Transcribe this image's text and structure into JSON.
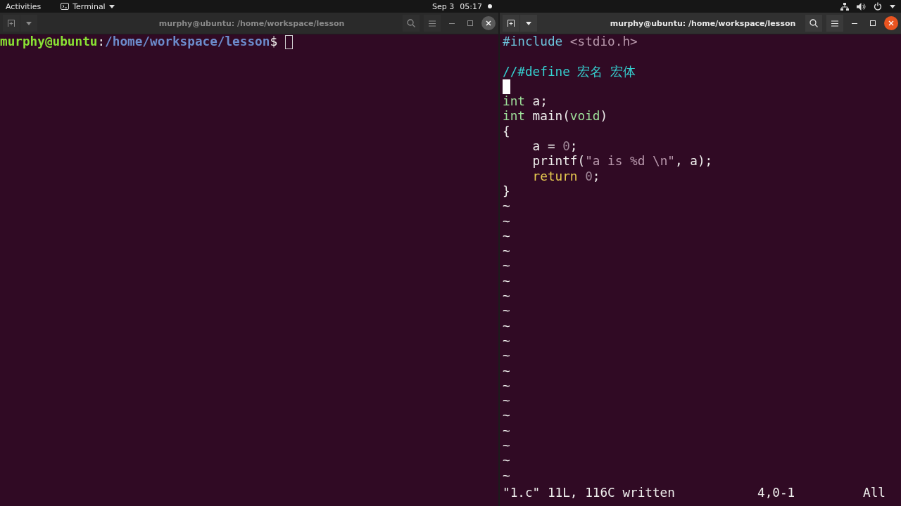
{
  "top_bar": {
    "activities": "Activities",
    "app_menu": "Terminal",
    "clock": {
      "date": "Sep 3",
      "time": "05:17"
    }
  },
  "windows": [
    {
      "kind": "shell",
      "title": "murphy@ubuntu: /home/workspace/lesson",
      "focused": false,
      "prompt": {
        "user_host": "murphy@ubuntu",
        "separator": ":",
        "path": "/home/workspace/lesson",
        "symbol": "$"
      }
    },
    {
      "kind": "vim",
      "title": "murphy@ubuntu: /home/workspace/lesson",
      "focused": true,
      "lines": [
        {
          "cursor": false,
          "segments": [
            {
              "text": "#include",
              "kind": "preproc"
            },
            {
              "text": " <stdio.h>",
              "kind": "string"
            }
          ]
        },
        {
          "cursor": false
        },
        {
          "cursor": false,
          "segments": [
            {
              "text": "//#define 宏名 宏体",
              "kind": "comment"
            }
          ]
        },
        {
          "cursor": true
        },
        {
          "cursor": false,
          "segments": [
            {
              "text": "int",
              "kind": "type"
            },
            {
              "text": " a;",
              "kind": "plain"
            }
          ]
        },
        {
          "cursor": false,
          "segments": [
            {
              "text": "int",
              "kind": "type"
            },
            {
              "text": " main(",
              "kind": "plain"
            },
            {
              "text": "void",
              "kind": "type"
            },
            {
              "text": ")",
              "kind": "plain"
            }
          ]
        },
        {
          "cursor": false,
          "segments": [
            {
              "text": "{",
              "kind": "plain"
            }
          ]
        },
        {
          "cursor": false,
          "indented": true,
          "segments": [
            {
              "text": "a = ",
              "kind": "plain"
            },
            {
              "text": "0",
              "kind": "number"
            },
            {
              "text": ";",
              "kind": "plain"
            }
          ]
        },
        {
          "cursor": false,
          "indented": true,
          "segments": [
            {
              "text": "printf(",
              "kind": "plain"
            },
            {
              "text": "\"a is %d \\n\"",
              "kind": "string"
            },
            {
              "text": ", a);",
              "kind": "plain"
            }
          ]
        },
        {
          "cursor": false,
          "indented": true,
          "segments": [
            {
              "text": "return",
              "kind": "statement"
            },
            {
              "text": " 0",
              "kind": "number"
            },
            {
              "text": ";",
              "kind": "plain"
            }
          ]
        },
        {
          "cursor": false,
          "segments": [
            {
              "text": "}",
              "kind": "plain"
            }
          ]
        }
      ],
      "tildes": [
        "~",
        "~",
        "~",
        "~",
        "~",
        "~",
        "~",
        "~",
        "~",
        "~",
        "~",
        "~",
        "~",
        "~",
        "~",
        "~",
        "~",
        "~",
        "~"
      ],
      "status": {
        "message": "\"1.c\" 11L, 116C written",
        "position": "4,0-1",
        "scroll": "All"
      }
    }
  ]
}
